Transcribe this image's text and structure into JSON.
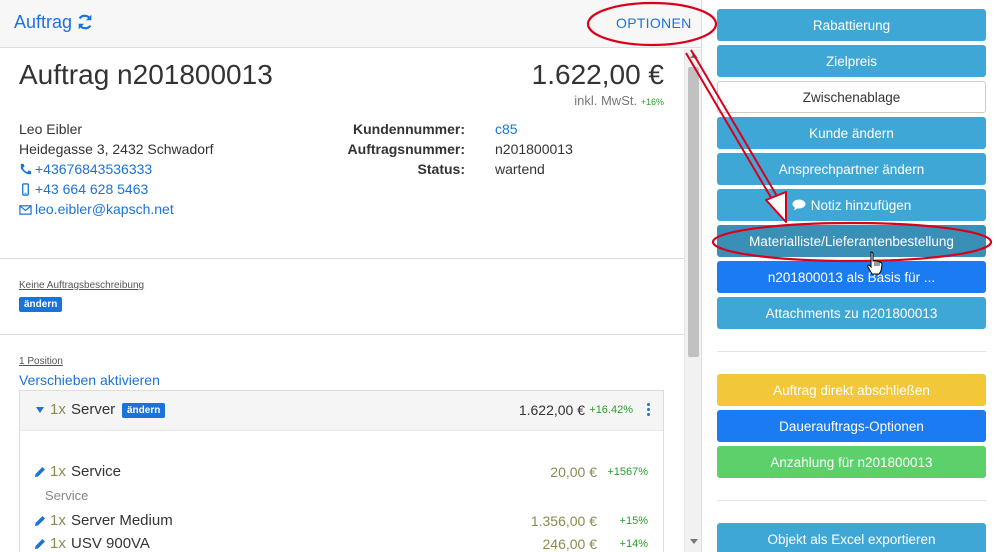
{
  "header": {
    "title": "Auftrag",
    "options_label": "OPTIONEN"
  },
  "order": {
    "heading": "Auftrag n201800013",
    "total": "1.622,00 €",
    "tax_note": "inkl. MwSt.",
    "tax_pct": "+16%"
  },
  "customer": {
    "name": "Leo Eibler",
    "address": "Heidegasse 3, 2432 Schwadorf",
    "phone": "+43676843536333",
    "mobile": "+43 664 628 5463",
    "email": "leo.eibler@kapsch.net"
  },
  "meta": [
    {
      "label": "Kundennummer:",
      "value": "c85",
      "link": true
    },
    {
      "label": "Auftragsnummer:",
      "value": "n201800013",
      "link": false
    },
    {
      "label": "Status:",
      "value": "wartend",
      "link": false
    }
  ],
  "description": {
    "label": "Keine Auftragsbeschreibung",
    "edit_badge": "ändern"
  },
  "positions": {
    "count_label": "1 Position",
    "move_link": "Verschieben aktivieren",
    "group": {
      "qty": "1x",
      "name": "Server",
      "edit_badge": "ändern",
      "price": "1.622,00 €",
      "pct": "+16.42%"
    },
    "items": [
      {
        "qty": "1x",
        "name": "Service",
        "price": "20,00 €",
        "pct": "+1567%",
        "sub": "Service"
      },
      {
        "qty": "1x",
        "name": "Server Medium",
        "price": "1.356,00 €",
        "pct": "+15%"
      },
      {
        "qty": "1x",
        "name": "USV 900VA",
        "price": "246,00 €",
        "pct": "+14%"
      }
    ]
  },
  "actions": {
    "rabattierung": "Rabattierung",
    "zielpreis": "Zielpreis",
    "zwischenablage": "Zwischenablage",
    "kunde_aendern": "Kunde ändern",
    "ansprechpartner": "Ansprechpartner ändern",
    "notiz": "Notiz hinzufügen",
    "materialliste": "Materialliste/Lieferantenbestellung",
    "als_basis": "n201800013 als Basis für ...",
    "attachments": "Attachments zu n201800013",
    "abschliessen": "Auftrag direkt abschließen",
    "dauerauftrag": "Dauerauftrags-Optionen",
    "anzahlung": "Anzahlung für n201800013",
    "excel": "Objekt als Excel exportieren"
  },
  "colors": {
    "accent": "#1a73d9",
    "info": "#3fa7d6",
    "primary": "#1a7bf2",
    "warning": "#f3c73a",
    "success": "#5cd16b",
    "annotation": "#d9001b"
  }
}
